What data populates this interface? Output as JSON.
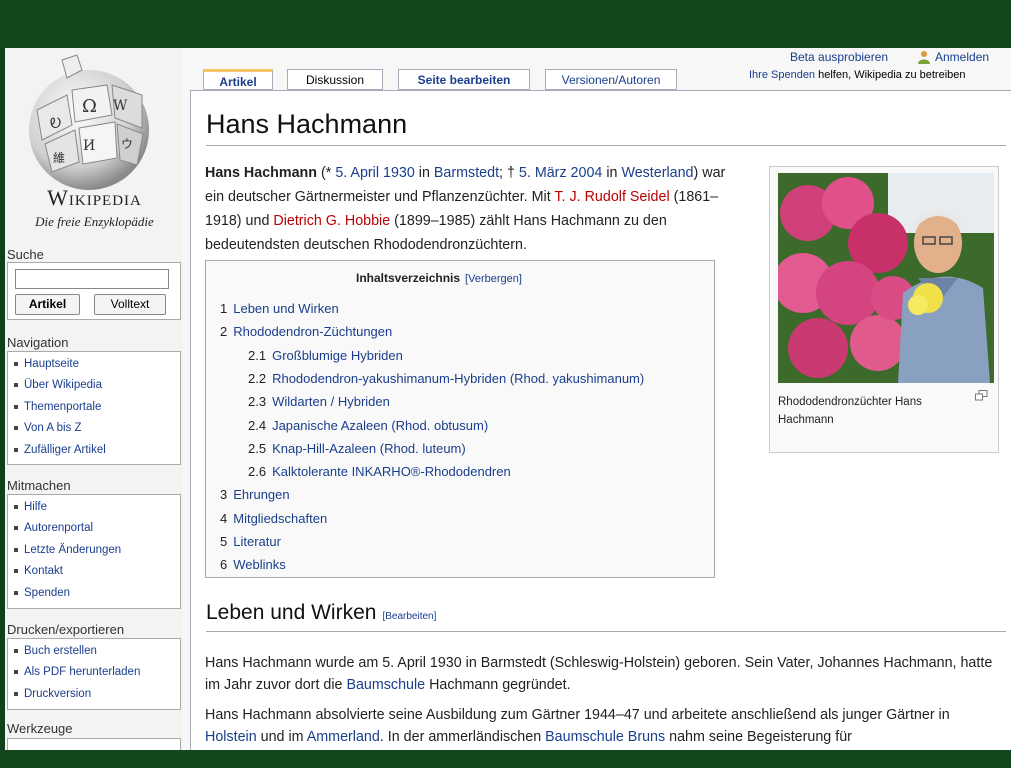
{
  "sidebar": {
    "logo": {
      "title": "Wikipedia",
      "subtitle": "Die freie Enzyklopädie"
    },
    "search": {
      "heading": "Suche",
      "article_button": "Artikel",
      "fulltext_button": "Volltext"
    },
    "navigation": {
      "heading": "Navigation",
      "items": [
        "Hauptseite",
        "Über Wikipedia",
        "Themenportale",
        "Von A bis Z",
        "Zufälliger Artikel"
      ]
    },
    "participate": {
      "heading": "Mitmachen",
      "items": [
        "Hilfe",
        "Autorenportal",
        "Letzte Änderungen",
        "Kontakt",
        "Spenden"
      ]
    },
    "print": {
      "heading": "Drucken/exportieren",
      "items": [
        "Buch erstellen",
        "Als PDF herunterladen",
        "Druckversion"
      ]
    },
    "tools": {
      "heading": "Werkzeuge"
    }
  },
  "personal": {
    "beta": "Beta ausprobieren",
    "login": "Anmelden",
    "donate_link": "Ihre Spenden",
    "donate_text": "helfen, Wikipedia zu betreiben"
  },
  "tabs": [
    "Artikel",
    "Diskussion",
    "Seite bearbeiten",
    "Versionen/Autoren"
  ],
  "article": {
    "title": "Hans Hachmann",
    "intro": {
      "bold": "Hans Hachmann",
      "t1": " (* ",
      "birth_date": "5. April 1930",
      "t2": " in ",
      "birth_place": "Barmstedt",
      "t3": "; † ",
      "death_date": "5. März 2004",
      "t4": " in ",
      "death_place": "Westerland",
      "t5": ") war ein deutscher Gärtnermeister und Pflanzenzüchter. Mit ",
      "person1": "T. J. Rudolf Seidel",
      "t6": " (1861–1918) und ",
      "person2": "Dietrich G. Hobbie",
      "t7": " (1899–1985) zählt Hans Hachmann zu den bedeutendsten deutschen Rhododendronzüchtern."
    },
    "toc": {
      "title": "Inhaltsverzeichnis",
      "hide": "[Verbergen]",
      "items": [
        {
          "num": "1",
          "text": "Leben und Wirken"
        },
        {
          "num": "2",
          "text": "Rhododendron-Züchtungen"
        },
        {
          "num": "2.1",
          "text": "Großblumige Hybriden"
        },
        {
          "num": "2.2",
          "text": "Rhododendron-yakushimanum-Hybriden (Rhod. yakushimanum)"
        },
        {
          "num": "2.3",
          "text": "Wildarten / Hybriden"
        },
        {
          "num": "2.4",
          "text": "Japanische Azaleen (Rhod. obtusum)"
        },
        {
          "num": "2.5",
          "text": "Knap-Hill-Azaleen (Rhod. luteum)"
        },
        {
          "num": "2.6",
          "text": "Kalktolerante INKARHO®-Rhododendren"
        },
        {
          "num": "3",
          "text": "Ehrungen"
        },
        {
          "num": "4",
          "text": "Mitgliedschaften"
        },
        {
          "num": "5",
          "text": "Literatur"
        },
        {
          "num": "6",
          "text": "Weblinks"
        }
      ]
    },
    "thumb": {
      "caption": "Rhododendronzüchter Hans Hachmann"
    },
    "section1": {
      "heading": "Leben und Wirken",
      "edit": "[Bearbeiten]",
      "p1_a": "Hans Hachmann wurde am 5. April 1930 in Barmstedt (Schleswig-Holstein) geboren. Sein Vater, Johannes Hachmann, hatte im Jahr zuvor dort die ",
      "p1_link": "Baumschule",
      "p1_b": " Hachmann gegründet.",
      "p2_a": "Hans Hachmann absolvierte seine Ausbildung zum Gärtner 1944–47 und arbeitete anschließend als junger Gärtner in ",
      "p2_link1": "Holstein",
      "p2_b": " und im ",
      "p2_link2": "Ammerland",
      "p2_c": ". In der ammerländischen ",
      "p2_link3": "Baumschule Bruns",
      "p2_d": " nahm seine Begeisterung für"
    }
  },
  "colors": {
    "frame": "#13471e",
    "link": "#1a3e8c",
    "new_link": "#ba0000",
    "tab_accent": "#f6c56a"
  }
}
